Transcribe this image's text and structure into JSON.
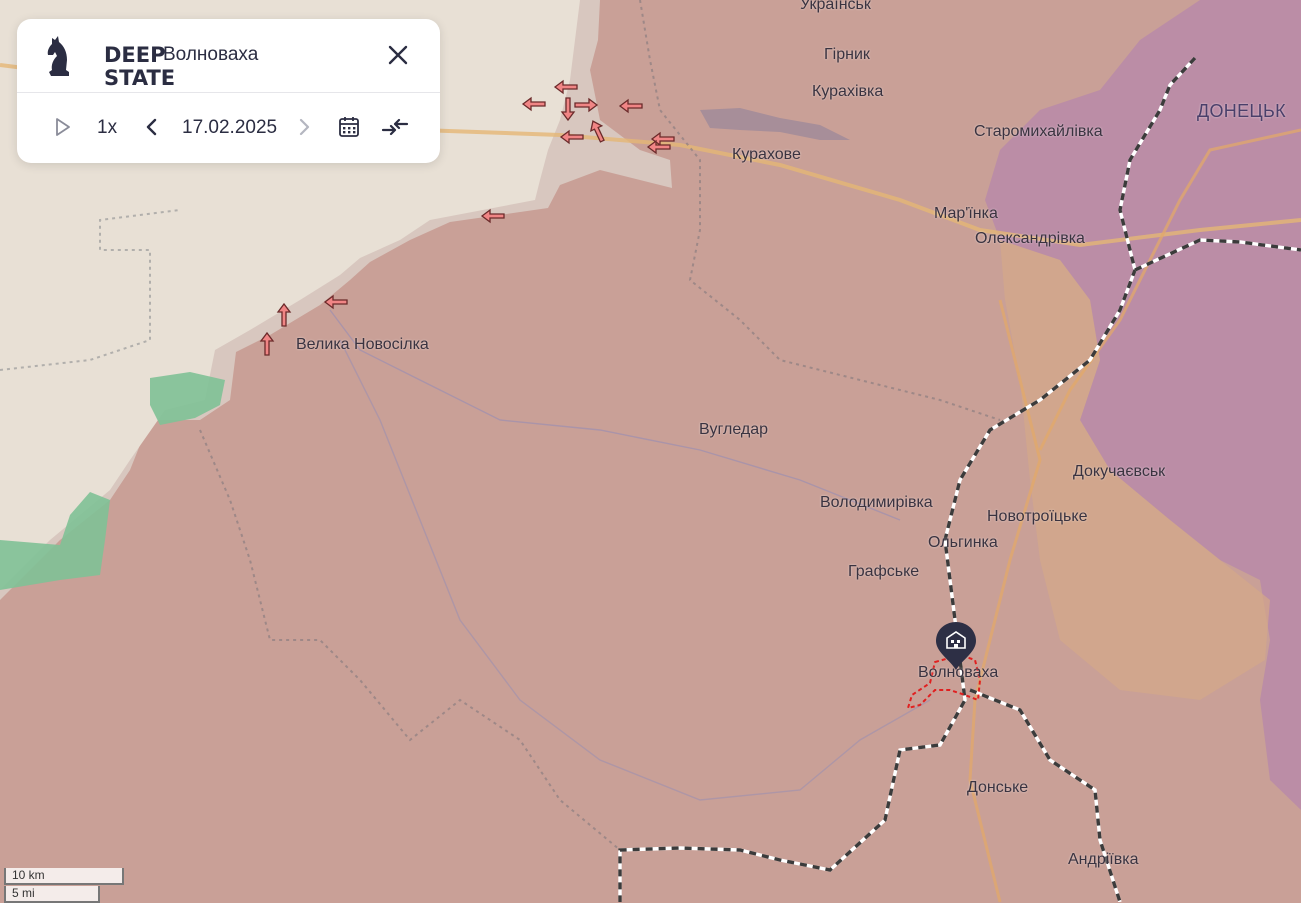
{
  "colors": {
    "occupied": "#c9a097",
    "liberated": "#e6ddd3",
    "crimea_dnr_2014": "#b88aa8",
    "contested": "#d4a889",
    "forest": "#7fc196",
    "accent": "#2b2d42"
  },
  "panel": {
    "logo_line1": "DEEP",
    "logo_line2": "STATE",
    "title": "Волноваха",
    "speed": "1x",
    "date": "17.02.2025",
    "icons": [
      "play-icon",
      "chevron-left-icon",
      "chevron-right-icon",
      "calendar-icon",
      "collapse-icon",
      "close-icon"
    ]
  },
  "places": {
    "ukrainsk": "Українськ",
    "hirnyk": "Гірник",
    "kurakhivka": "Курахівка",
    "kurakhove": "Курахове",
    "staromykhailivka": "Старомихайлівка",
    "donetsk": "ДОНЕЦЬК",
    "marinka": "Мар'їнка",
    "oleksandrivka": "Олександрівка",
    "velyka_novosilka": "Велика Новосілка",
    "vuhledar": "Вугледар",
    "dokuchaievsk": "Докучаєвськ",
    "volodymyrivka": "Володимирівка",
    "novotroitske": "Новотроїцьке",
    "olhynka": "Ольгинка",
    "hrafske": "Графське",
    "volnovakha": "Волноваха",
    "donske": "Донське",
    "andriivka": "Андріївка"
  },
  "scale": {
    "km": "10 km",
    "mi": "5 mi"
  }
}
